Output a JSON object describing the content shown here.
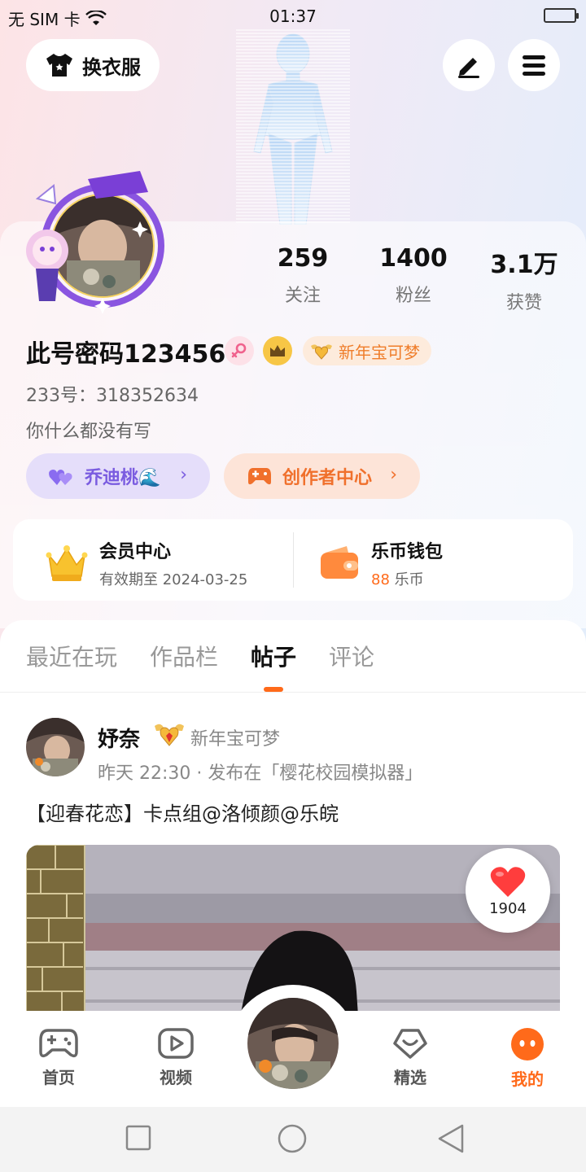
{
  "status_bar": {
    "carrier": "无 SIM 卡",
    "time": "01:37"
  },
  "top_bar": {
    "outfit_label": "换衣服",
    "edit_icon": "pencil-icon",
    "menu_icon": "hamburger-menu-icon"
  },
  "profile": {
    "username": "此号密码123456",
    "title_badge": "新年宝可梦",
    "uid": "233号：318352634",
    "bio": "你什么都没有写",
    "stats": [
      {
        "value": "259",
        "label": "关注"
      },
      {
        "value": "1400",
        "label": "粉丝"
      },
      {
        "value": "3.1万",
        "label": "获赞"
      }
    ],
    "partner_pill": "乔迪桃🌊",
    "creator_pill": "创作者中心"
  },
  "vip": {
    "member_title": "会员中心",
    "member_expiry": "有效期至 2024-03-25",
    "wallet_title": "乐币钱包",
    "wallet_amount": "88",
    "wallet_unit": "乐币"
  },
  "tabs": [
    "最近在玩",
    "作品栏",
    "帖子",
    "评论"
  ],
  "active_tab": "帖子",
  "post": {
    "author": "妤奈",
    "badge": "新年宝可梦",
    "meta": "昨天 22:30 · 发布在「樱花校园模拟器」",
    "text": "【迎春花恋】卡点组@洛倾颜@乐皖",
    "likes": "1904"
  },
  "bottom_nav": [
    {
      "label": "首页",
      "icon": "gamepad-icon"
    },
    {
      "label": "视频",
      "icon": "play-icon"
    },
    {
      "label": "精选",
      "icon": "heart-chat-icon"
    },
    {
      "label": "我的",
      "icon": "face-icon"
    }
  ],
  "colors": {
    "accent": "#ff6a1a",
    "purple": "#7a5ce0",
    "gold": "#f7c646"
  }
}
